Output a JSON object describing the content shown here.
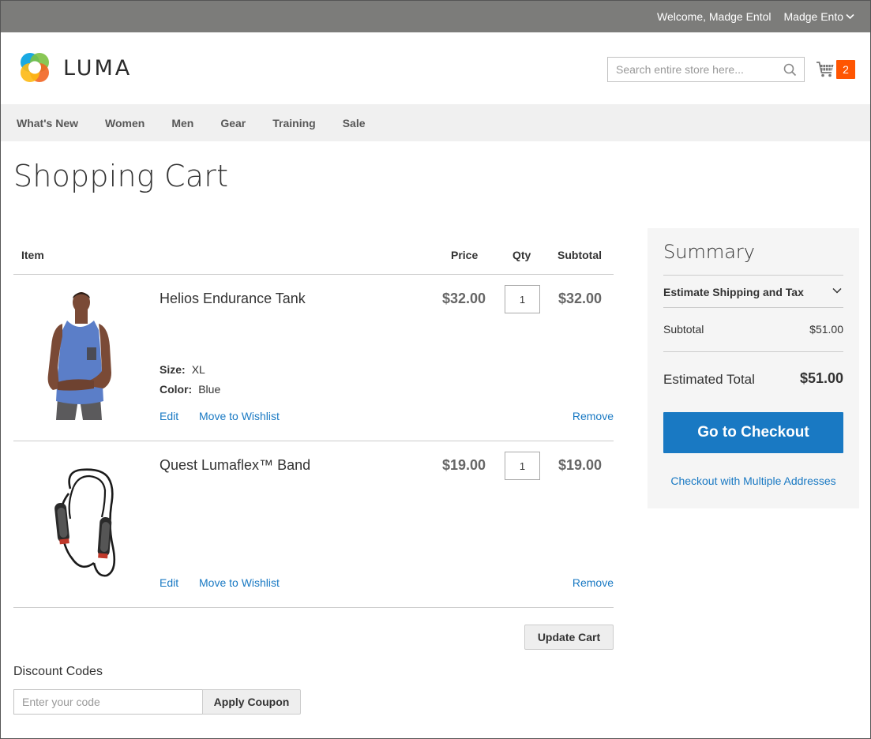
{
  "topbar": {
    "welcome": "Welcome, Madge Entol",
    "account": "Madge Ento"
  },
  "header": {
    "logo_text": "LUMA",
    "search_placeholder": "Search entire store here...",
    "cart_count": "2"
  },
  "nav": {
    "items": [
      "What's New",
      "Women",
      "Men",
      "Gear",
      "Training",
      "Sale"
    ]
  },
  "page": {
    "title": "Shopping Cart"
  },
  "cart": {
    "headers": {
      "item": "Item",
      "price": "Price",
      "qty": "Qty",
      "subtotal": "Subtotal"
    },
    "items": [
      {
        "name": "Helios Endurance Tank",
        "options": [
          {
            "label": "Size:",
            "value": "XL"
          },
          {
            "label": "Color:",
            "value": "Blue"
          }
        ],
        "price": "$32.00",
        "qty": "1",
        "subtotal": "$32.00",
        "edit": "Edit",
        "wishlist": "Move to Wishlist",
        "remove": "Remove"
      },
      {
        "name": "Quest Lumaflex™ Band",
        "price": "$19.00",
        "qty": "1",
        "subtotal": "$19.00",
        "edit": "Edit",
        "wishlist": "Move to Wishlist",
        "remove": "Remove"
      }
    ],
    "update_label": "Update Cart"
  },
  "discount": {
    "title": "Discount Codes",
    "placeholder": "Enter your code",
    "apply_label": "Apply Coupon"
  },
  "summary": {
    "title": "Summary",
    "shipping_label": "Estimate Shipping and Tax",
    "subtotal_label": "Subtotal",
    "subtotal_value": "$51.00",
    "total_label": "Estimated Total",
    "total_value": "$51.00",
    "checkout_label": "Go to Checkout",
    "multi_label": "Checkout with Multiple Addresses"
  },
  "colors": {
    "topbar": "#7c7c7a",
    "nav_bg": "#f0f0f0",
    "link": "#1979c3",
    "checkout": "#1979c3",
    "cart_badge": "#ff5501",
    "summary_bg": "#f5f5f5"
  }
}
